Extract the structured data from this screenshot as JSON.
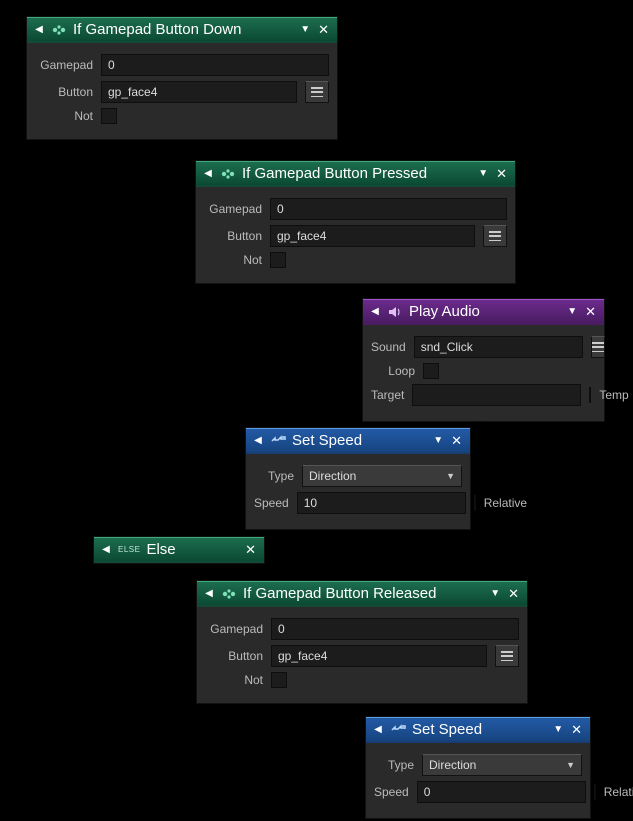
{
  "nodes": {
    "ifDown": {
      "title": "If Gamepad Button Down",
      "gamepad_label": "Gamepad",
      "gamepad_value": "0",
      "button_label": "Button",
      "button_value": "gp_face4",
      "not_label": "Not"
    },
    "ifPressed": {
      "title": "If Gamepad Button Pressed",
      "gamepad_label": "Gamepad",
      "gamepad_value": "0",
      "button_label": "Button",
      "button_value": "gp_face4",
      "not_label": "Not"
    },
    "playAudio": {
      "title": "Play Audio",
      "sound_label": "Sound",
      "sound_value": "snd_Click",
      "loop_label": "Loop",
      "target_label": "Target",
      "target_value": "",
      "temp_label": "Temp"
    },
    "setSpeed1": {
      "title": "Set Speed",
      "type_label": "Type",
      "type_value": "Direction",
      "speed_label": "Speed",
      "speed_value": "10",
      "relative_label": "Relative"
    },
    "else": {
      "badge": "ELSE",
      "title": "Else"
    },
    "ifReleased": {
      "title": "If Gamepad Button Released",
      "gamepad_label": "Gamepad",
      "gamepad_value": "0",
      "button_label": "Button",
      "button_value": "gp_face4",
      "not_label": "Not"
    },
    "setSpeed2": {
      "title": "Set Speed",
      "type_label": "Type",
      "type_value": "Direction",
      "speed_label": "Speed",
      "speed_value": "0",
      "relative_label": "Relative"
    }
  }
}
